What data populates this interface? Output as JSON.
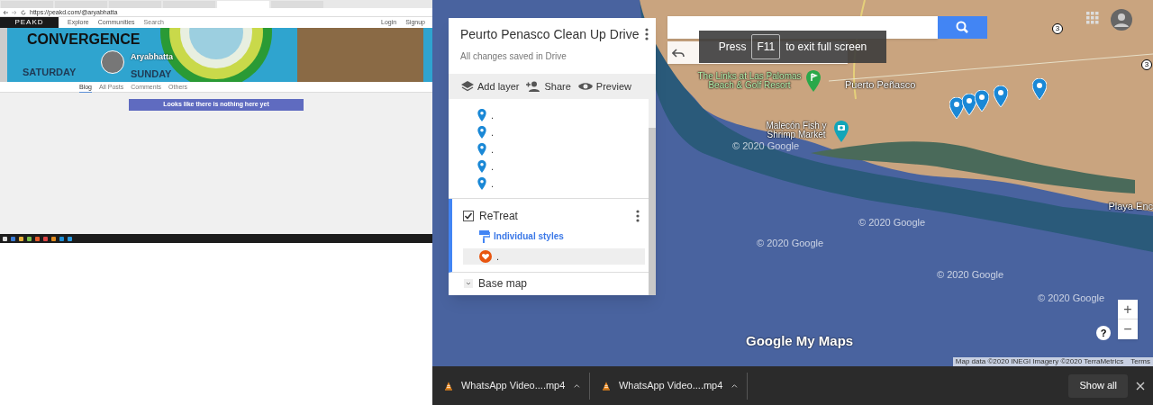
{
  "left_screenshot": {
    "tabs": [
      {
        "selected": false
      },
      {
        "selected": false
      },
      {
        "selected": false
      },
      {
        "selected": false
      },
      {
        "selected": true
      },
      {
        "selected": false
      }
    ],
    "address": "https://peakd.com/@aryabhatta",
    "site": {
      "logo": "PEAKD",
      "nav": [
        "Explore",
        "Communities"
      ],
      "search_placeholder": "Search",
      "login": "Login",
      "signup": "Signup"
    },
    "cover": {
      "headline_1": "CONVERGENCE",
      "headline_2": "SATURDAY",
      "headline_3": "SUNDAY"
    },
    "profile": {
      "name": "Aryabhatta"
    },
    "profile_tabs": [
      {
        "label": "Blog",
        "selected": true
      },
      {
        "label": "All Posts",
        "selected": false
      },
      {
        "label": "Comments",
        "selected": false
      },
      {
        "label": "Others",
        "selected": false
      }
    ],
    "empty_message": "Looks like there is nothing here yet"
  },
  "map": {
    "title": "Peurto Penasco Clean Up Drive",
    "save_status": "All changes saved in Drive",
    "actions": [
      "Add layer",
      "Share",
      "Preview"
    ],
    "points": [
      {
        "label": "."
      },
      {
        "label": "."
      },
      {
        "label": "."
      },
      {
        "label": "."
      },
      {
        "label": "."
      }
    ],
    "layer": {
      "name": "ReTreat",
      "checked": true,
      "style": "Individual styles",
      "items": [
        {
          "label": ".",
          "selected": true
        }
      ]
    },
    "base_map": "Base map",
    "fullscreen_notice": {
      "before": "Press",
      "key": "F11",
      "after": "to exit full screen"
    },
    "places": [
      "The Links at Las Palomas Beach & Golf Resort",
      "Puerto Peñasco",
      "Malecón Fish y Shrimp Market",
      "Playa Enc"
    ],
    "road_numbers": [
      "3",
      "3"
    ],
    "watermarks": [
      "© 2020 Google",
      "© 2020 Google",
      "© 2020 Google",
      "© 2020 Google",
      "© 2020 Google"
    ],
    "logo": "Google My Maps",
    "zoom_in": "+",
    "zoom_out": "−",
    "help": "?",
    "attribution": "Map data ©2020 INEGI Imagery ©2020 TerraMetrics",
    "terms": "Terms"
  },
  "downloads": {
    "items": [
      {
        "name": "WhatsApp Video....mp4"
      },
      {
        "name": "WhatsApp Video....mp4"
      }
    ],
    "show_all": "Show all"
  }
}
